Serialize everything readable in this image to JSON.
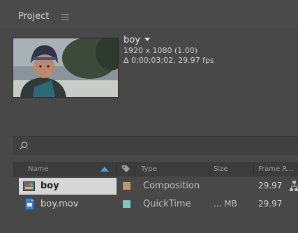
{
  "panel": {
    "tab_label": "Project"
  },
  "preview": {
    "name": "boy",
    "resolution": "1920 x 1080 (1.00)",
    "duration_fps": "Δ 0;00;03;02, 29.97 fps"
  },
  "search": {
    "icon": "search-icon"
  },
  "columns": {
    "name": "Name",
    "type": "Type",
    "size": "Size",
    "frame_rate": "Frame R..."
  },
  "items": [
    {
      "name": "boy",
      "type": "Composition",
      "size": "",
      "frame_rate": "29.97",
      "label_color": "#b89a6a",
      "icon": "composition-icon",
      "selected": true
    },
    {
      "name": "boy.mov",
      "type": "QuickTime",
      "size": "... MB",
      "frame_rate": "29.97",
      "label_color": "#7ec8c0",
      "icon": "footage-icon",
      "selected": false
    }
  ],
  "colors": {
    "sort_arrow": "#4aa3e0",
    "selection": "#d6d6d6"
  }
}
